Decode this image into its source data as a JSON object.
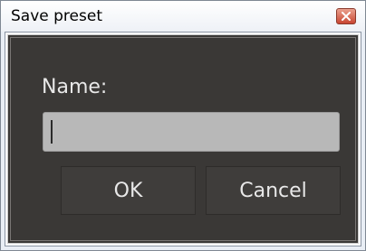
{
  "window": {
    "title": "Save preset"
  },
  "form": {
    "name_label": "Name:",
    "name_value": ""
  },
  "buttons": {
    "ok_label": "OK",
    "cancel_label": "Cancel"
  },
  "icons": {
    "close": "close-icon"
  },
  "colors": {
    "panel_bg": "#3a3836",
    "input_bg": "#b8b8b8",
    "close_button": "#c94631",
    "text_light": "#e8e8e8"
  }
}
